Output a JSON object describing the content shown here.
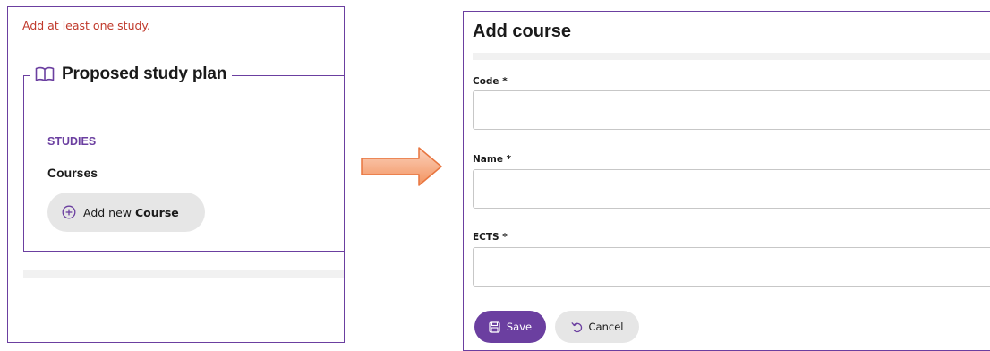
{
  "left_panel": {
    "error_message": "Add at least one study.",
    "fieldset": {
      "legend_icon": "open-book-icon",
      "legend_title": "Proposed study plan",
      "studies_heading": "STUDIES",
      "courses_heading": "Courses",
      "add_button": {
        "icon": "plus-circle-icon",
        "prefix": "Add new",
        "bold": "Course"
      }
    }
  },
  "arrow": {
    "icon": "arrow-right-icon",
    "color": "#f5a07a"
  },
  "dialog": {
    "title": "Add course",
    "fields": [
      {
        "label": "Code *",
        "value": ""
      },
      {
        "label": "Name *",
        "value": ""
      },
      {
        "label": "ECTS *",
        "value": ""
      }
    ],
    "save_button": {
      "icon": "save-icon",
      "label": "Save"
    },
    "cancel_button": {
      "icon": "undo-icon",
      "label": "Cancel"
    }
  },
  "colors": {
    "accent": "#6b3fa0",
    "error": "#c0392b",
    "button_neutral": "#e6e6e6"
  }
}
